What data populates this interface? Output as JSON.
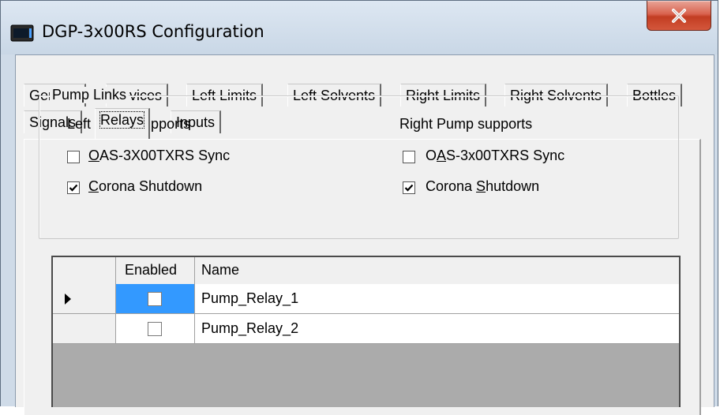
{
  "window": {
    "title": "DGP-3x00RS Configuration",
    "icon": "app-icon",
    "close_icon": "close-x-icon"
  },
  "tabs": [
    {
      "label": "General",
      "active": false
    },
    {
      "label": "Devices",
      "active": false
    },
    {
      "label": "Left Limits",
      "active": false
    },
    {
      "label": "Left Solvents",
      "active": false
    },
    {
      "label": "Right Limits",
      "active": false
    },
    {
      "label": "Right Solvents",
      "active": false
    },
    {
      "label": "Bottles",
      "active": false
    },
    {
      "label": "Signals",
      "active": false
    },
    {
      "label": "Relays",
      "active": true
    },
    {
      "label": "Inputs",
      "active": false
    }
  ],
  "pump_links": {
    "title": "Pump Links",
    "left": {
      "heading": "Left Pump supports",
      "sync": {
        "mnemonic": "O",
        "rest": "AS-3X00TXRS Sync",
        "checked": false
      },
      "shutdown": {
        "mnemonic": "C",
        "rest": "orona Shutdown",
        "checked": true
      }
    },
    "right": {
      "heading": "Right Pump supports",
      "sync": {
        "pre": "O",
        "mnemonic": "A",
        "rest": "S-3x00TXRS Sync",
        "checked": false
      },
      "shutdown": {
        "pre": "Corona ",
        "mnemonic": "S",
        "rest": "hutdown",
        "checked": true
      }
    }
  },
  "relay_grid": {
    "columns": [
      "Enabled",
      "Name"
    ],
    "current_row_icon": "row-pointer-icon",
    "rows": [
      {
        "enabled": false,
        "name": "Pump_Relay_1",
        "current": true
      },
      {
        "enabled": false,
        "name": "Pump_Relay_2",
        "current": false
      }
    ]
  },
  "colors": {
    "selection": "#3399ff",
    "close_button": "#c94a30",
    "frame": "#cfdbe8"
  }
}
